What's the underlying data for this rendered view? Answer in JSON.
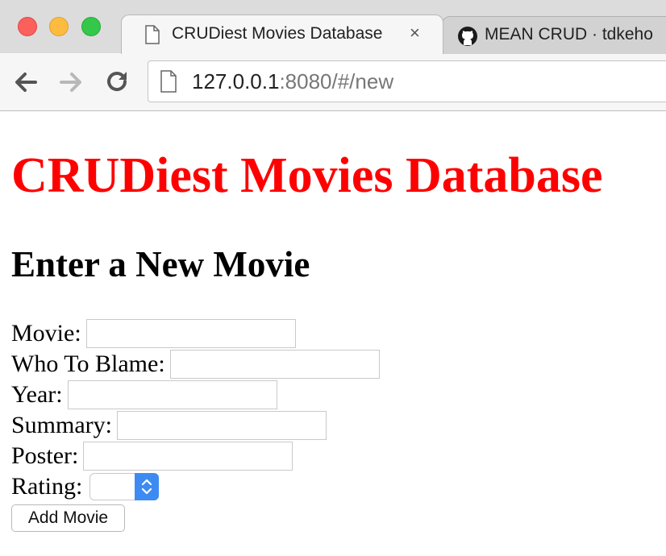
{
  "browser": {
    "active_tab": {
      "title": "CRUDiest Movies Database",
      "close_glyph": "×"
    },
    "inactive_tab": {
      "title": "MEAN CRUD · tdkeho"
    },
    "url": {
      "host": "127.0.0.1",
      "rest": ":8080/#/new"
    },
    "icons": [
      "back-arrow-icon",
      "forward-arrow-icon",
      "reload-icon",
      "page-icon",
      "github-icon"
    ]
  },
  "page": {
    "site_title": "CRUDiest Movies Database",
    "form_title": "Enter a New Movie",
    "fields": {
      "movie": {
        "label": "Movie:",
        "value": ""
      },
      "blame": {
        "label": "Who To Blame:",
        "value": ""
      },
      "year": {
        "label": "Year:",
        "value": ""
      },
      "summary": {
        "label": "Summary:",
        "value": ""
      },
      "poster": {
        "label": "Poster:",
        "value": ""
      },
      "rating": {
        "label": "Rating:",
        "selected": ""
      }
    },
    "submit_label": "Add Movie",
    "colors": {
      "title": "#ff0000",
      "select_accent": "#3d8bf2"
    }
  }
}
